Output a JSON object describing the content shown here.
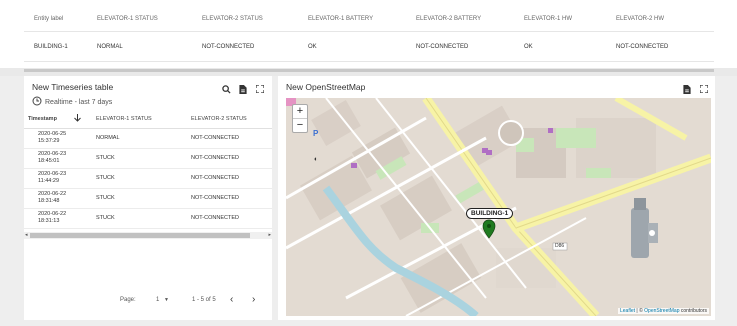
{
  "entity_table": {
    "columns": [
      "Entity label",
      "ELEVATOR-1 STATUS",
      "ELEVATOR-2 STATUS",
      "ELEVATOR-1 BATTERY",
      "ELEVATOR-2 BATTERY",
      "ELEVATOR-1 HW",
      "ELEVATOR-2 HW"
    ],
    "row": [
      "BUILDING-1",
      "NORMAL",
      "NOT-CONNECTED",
      "OK",
      "NOT-CONNECTED",
      "OK",
      "NOT-CONNECTED"
    ]
  },
  "timeseries": {
    "title": "New Timeseries table",
    "realtime": "Realtime - last 7 days",
    "columns": [
      "Timestamp",
      "ELEVATOR-1 STATUS",
      "ELEVATOR-2 STATUS"
    ],
    "rows": [
      {
        "ts1": "2020-06-25",
        "ts2": "15:37:29",
        "e1": "NORMAL",
        "e2": "NOT-CONNECTED"
      },
      {
        "ts1": "2020-06-23",
        "ts2": "18:45:01",
        "e1": "STUCK",
        "e2": "NOT-CONNECTED"
      },
      {
        "ts1": "2020-06-23",
        "ts2": "11:44:29",
        "e1": "STUCK",
        "e2": "NOT-CONNECTED"
      },
      {
        "ts1": "2020-06-22",
        "ts2": "18:31:48",
        "e1": "STUCK",
        "e2": "NOT-CONNECTED"
      },
      {
        "ts1": "2020-06-22",
        "ts2": "18:31:13",
        "e1": "STUCK",
        "e2": "NOT-CONNECTED"
      }
    ],
    "pager": {
      "page_label": "Page:",
      "page": "1",
      "range": "1 - 5 of 5"
    }
  },
  "map": {
    "title": "New OpenStreetMap",
    "marker_label": "BUILDING-1",
    "road_label": "D86",
    "attribution_leaflet": "Leaflet",
    "attribution_sep": " | © ",
    "attribution_osm": "OpenStreetMap",
    "attribution_tail": " contributors",
    "zoom_in": "+",
    "zoom_out": "−"
  },
  "icons": {
    "search": "search-icon",
    "export": "export-icon",
    "fullscreen": "fullscreen-icon",
    "clock": "clock-icon",
    "sort": "sort-arrow-icon"
  }
}
